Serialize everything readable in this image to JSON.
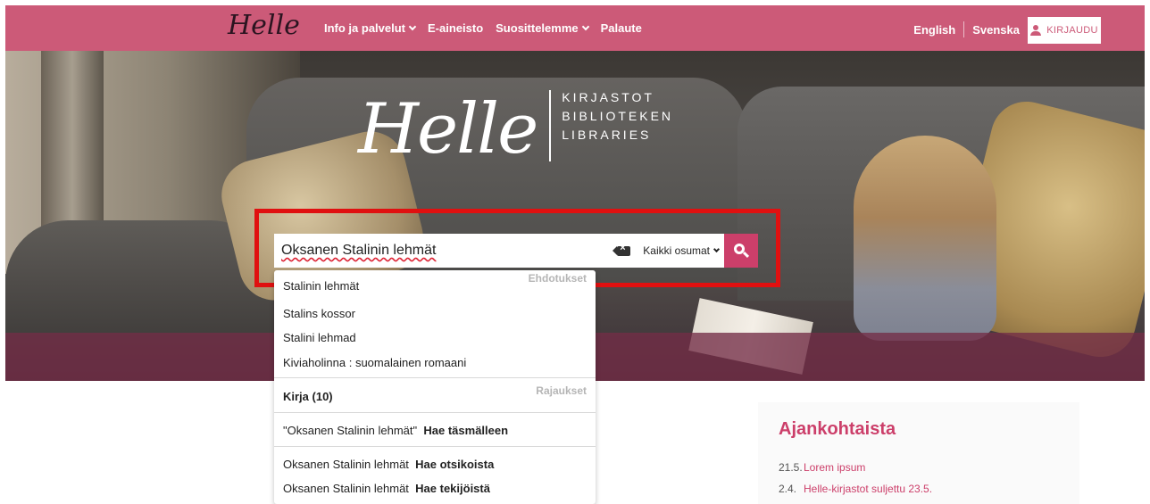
{
  "header": {
    "logo": "Helle",
    "nav": [
      {
        "label": "Info ja palvelut",
        "has_menu": true
      },
      {
        "label": "E-aineisto",
        "has_menu": false
      },
      {
        "label": "Suosittelemme",
        "has_menu": true
      },
      {
        "label": "Palaute",
        "has_menu": false
      }
    ],
    "languages": [
      "English",
      "Svenska"
    ],
    "login_label": "KIRJAUDU"
  },
  "hero": {
    "logo_script": "Helle",
    "logo_lines": [
      "KIRJASTOT",
      "BIBLIOTEKEN",
      "LIBRARIES"
    ]
  },
  "search": {
    "value": "Oksanen Stalinin lehmät",
    "scope": "Kaikki osumat",
    "icon": "search-icon"
  },
  "autocomplete": {
    "suggestions_header": "Ehdotukset",
    "suggestions": [
      "Stalinin lehmät",
      "Stalins kossor",
      "Stalini lehmad",
      "Kiviaholinna : suomalainen romaani"
    ],
    "filters_header": "Rajaukset",
    "filter": "Kirja (10)",
    "actions": [
      {
        "query": "\"Oksanen Stalinin lehmät\"",
        "action": "Hae täsmälleen"
      },
      {
        "query": "Oksanen Stalinin lehmät",
        "action": "Hae otsikoista"
      },
      {
        "query": "Oksanen Stalinin lehmät",
        "action": "Hae tekijöistä"
      }
    ]
  },
  "news": {
    "title": "Ajankohtaista",
    "items": [
      {
        "date": "21.5.",
        "text": "Lorem ipsum"
      },
      {
        "date": "2.4.",
        "text": "Helle-kirjastot suljettu 23.5."
      }
    ]
  },
  "colors": {
    "brand": "#cc5a78",
    "accent": "#cc3f6a",
    "highlight": "#e01010"
  }
}
